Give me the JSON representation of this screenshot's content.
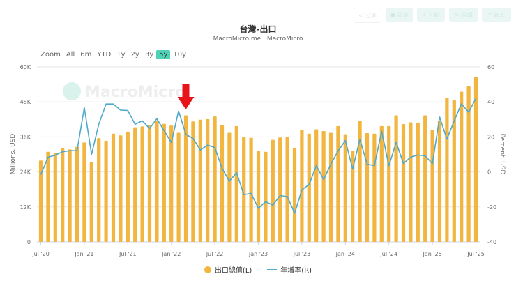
{
  "toolbar": {
    "buttons": [
      {
        "icon": "share-icon",
        "label": "分享"
      },
      {
        "icon": "gear-icon",
        "label": "設定"
      },
      {
        "icon": "download-icon",
        "label": "下載"
      },
      {
        "icon": "edit-icon",
        "label": "編輯"
      },
      {
        "icon": "embed-icon",
        "label": "嵌入"
      }
    ]
  },
  "range_selector": {
    "label": "Zoom",
    "options": [
      "All",
      "6m",
      "YTD",
      "1y",
      "2y",
      "3y",
      "5y",
      "10y"
    ],
    "selected": "5y"
  },
  "watermark": "MacroMicro",
  "colors": {
    "bars": "#f2b53f",
    "line": "#4fa9c9",
    "accent": "#4fd1b5",
    "arrow": "#e8141c"
  },
  "chart_data": {
    "type": "bar+line",
    "title": "台灣-出口",
    "subtitle": "MacroMicro.me | MacroMicro",
    "ylabel": "Millions, USD",
    "y2label": "Percent, USD",
    "ylim": [
      0,
      60000
    ],
    "y2lim": [
      -40,
      60
    ],
    "yticks": [
      "0",
      "12K",
      "24K",
      "36K",
      "48K",
      "60K"
    ],
    "y2ticks": [
      "-40",
      "-20",
      "0",
      "20",
      "40",
      "60"
    ],
    "xticks": [
      "Jul '20",
      "Jan '21",
      "Jul '21",
      "Jan '22",
      "Jul '22",
      "Jan '23",
      "Jul '23",
      "Jan '24",
      "Jul '24",
      "Jan '25",
      "Jul '25"
    ],
    "x_start": "2020-07",
    "x_end": "2025-07",
    "frequency": "monthly",
    "annotation": {
      "type": "arrow",
      "at": "2022-03"
    },
    "series": [
      {
        "name": "出口總值(L)",
        "type": "bar",
        "axis": "left",
        "values": [
          27900,
          30900,
          30500,
          32100,
          31700,
          32600,
          34100,
          27500,
          35600,
          34700,
          37100,
          36500,
          37800,
          39300,
          39600,
          40100,
          41500,
          40500,
          39900,
          37400,
          43400,
          41300,
          41900,
          42100,
          43000,
          40100,
          37400,
          39700,
          35900,
          35700,
          31300,
          30900,
          35000,
          35800,
          35900,
          32100,
          38500,
          37100,
          38600,
          38000,
          37400,
          39700,
          36900,
          31300,
          41500,
          37300,
          37100,
          39700,
          39700,
          43400,
          40400,
          41000,
          40900,
          43400,
          38500,
          41600,
          49400,
          48600,
          51500,
          53300,
          56500
        ]
      },
      {
        "name": "年增率(R)",
        "type": "line",
        "axis": "right",
        "values": [
          -1.6,
          8.4,
          9.6,
          11.5,
          12.1,
          12.1,
          36.8,
          10,
          27.3,
          38.8,
          38.8,
          35.3,
          35.1,
          27.2,
          29.2,
          24.8,
          30.4,
          23.6,
          16.8,
          34.8,
          21.5,
          19.1,
          12.5,
          15.3,
          14,
          2,
          -5.3,
          -0.4,
          -13,
          -12.3,
          -20.8,
          -17,
          -19,
          -13.5,
          -14.1,
          -23.6,
          -10.3,
          -7.1,
          3.6,
          -4.4,
          4.5,
          12,
          17.9,
          1.6,
          18.7,
          4.4,
          3.6,
          23.3,
          3.5,
          16.9,
          4.8,
          8.4,
          9.7,
          9.2,
          4.7,
          31.3,
          18.7,
          29.1,
          38.9,
          34.1,
          42
        ]
      }
    ]
  }
}
